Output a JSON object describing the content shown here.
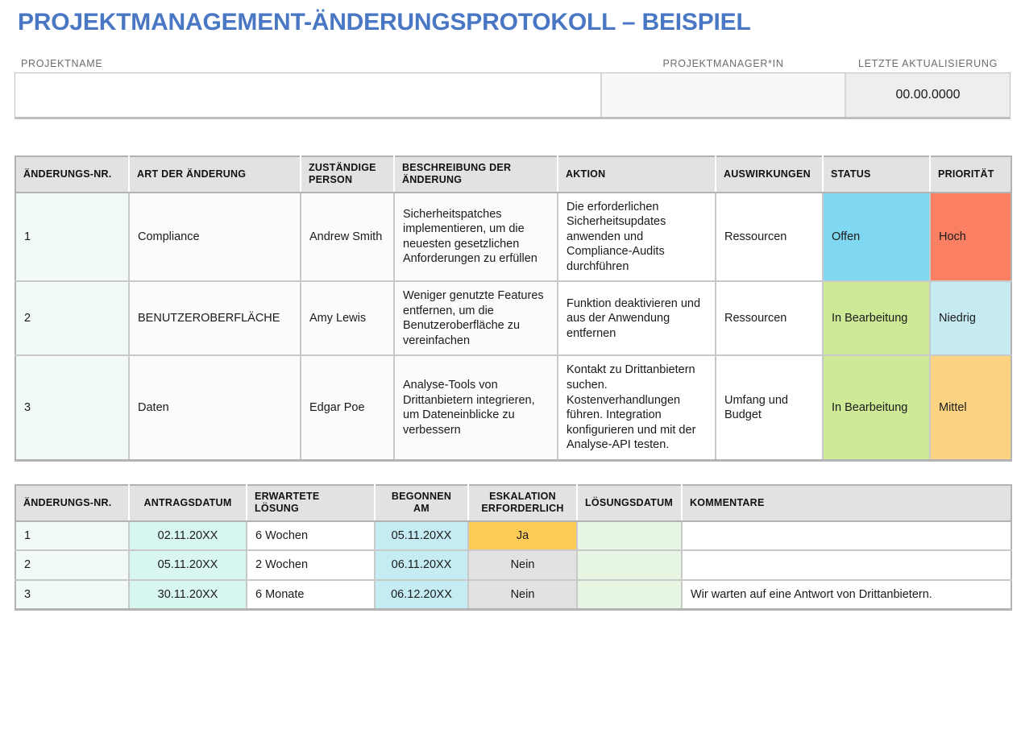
{
  "title": "PROJEKTMANAGEMENT-ÄNDERUNGSPROTOKOLL – BEISPIEL",
  "header": {
    "label_project_name": "PROJEKTNAME",
    "label_project_manager": "PROJEKTMANAGER*IN",
    "label_last_update": "LETZTE AKTUALISIERUNG",
    "value_project_name": "",
    "value_project_manager": "",
    "value_last_update": "00.00.0000"
  },
  "colors": {
    "title": "#4977c4",
    "header_bg": "#e2e2e2",
    "status_open": "#7fd7f2",
    "status_in_progress": "#cfea96",
    "priority_high": "#fb8063",
    "priority_low": "#c6eaf1",
    "priority_medium": "#fcd383",
    "escalation_yes": "#fbcb55",
    "escalation_no": "#e2e2e2",
    "date_mint": "#d9f7f1",
    "date_cyan": "#c5ecf2",
    "resolution_date": "#e7f6e3"
  },
  "table1": {
    "headers": [
      "ÄNDERUNGS-NR.",
      "ART DER ÄNDERUNG",
      "ZUSTÄNDIGE PERSON",
      "BESCHREIBUNG DER ÄNDERUNG",
      "AKTION",
      "AUSWIRKUNGEN",
      "STATUS",
      "PRIORITÄT"
    ],
    "rows": [
      {
        "nr": "1",
        "art": "Compliance",
        "person": "Andrew Smith",
        "beschreibung": "Sicherheitspatches implementieren, um die neuesten gesetzlichen Anforderungen zu erfüllen",
        "aktion": "Die erforderlichen Sicherheitsupdates anwenden und Compliance-Audits durchführen",
        "auswirkungen": "Ressourcen",
        "status": "Offen",
        "prioritaet": "Hoch"
      },
      {
        "nr": "2",
        "art": "BENUTZEROBERFLÄCHE",
        "person": "Amy Lewis",
        "beschreibung": "Weniger genutzte Features entfernen, um die Benutzeroberfläche zu vereinfachen",
        "aktion": "Funktion deaktivieren und aus der Anwendung entfernen",
        "auswirkungen": "Ressourcen",
        "status": "In Bearbeitung",
        "prioritaet": "Niedrig"
      },
      {
        "nr": "3",
        "art": "Daten",
        "person": "Edgar Poe",
        "beschreibung": "Analyse-Tools von Drittanbietern integrieren, um Dateneinblicke zu verbessern",
        "aktion": "Kontakt zu Drittanbietern suchen. Kostenverhandlungen führen. Integration konfigurieren und mit der Analyse-API testen.",
        "auswirkungen": "Umfang und Budget",
        "status": "In Bearbeitung",
        "prioritaet": "Mittel"
      }
    ]
  },
  "table2": {
    "headers": [
      "ÄNDERUNGS-NR.",
      "ANTRAGSDATUM",
      "ERWARTETE LÖSUNG",
      "BEGONNEN AM",
      "ESKALATION ERFORDERLICH",
      "LÖSUNGSDATUM",
      "KOMMENTARE"
    ],
    "rows": [
      {
        "nr": "1",
        "antragsdatum": "02.11.20XX",
        "erwartete_loesung": "6 Wochen",
        "begonnen_am": "05.11.20XX",
        "eskalation": "Ja",
        "loesungsdatum": "",
        "kommentare": ""
      },
      {
        "nr": "2",
        "antragsdatum": "05.11.20XX",
        "erwartete_loesung": "2 Wochen",
        "begonnen_am": "06.11.20XX",
        "eskalation": "Nein",
        "loesungsdatum": "",
        "kommentare": ""
      },
      {
        "nr": "3",
        "antragsdatum": "30.11.20XX",
        "erwartete_loesung": "6 Monate",
        "begonnen_am": "06.12.20XX",
        "eskalation": "Nein",
        "loesungsdatum": "",
        "kommentare": "Wir warten auf eine Antwort von Drittanbietern."
      }
    ]
  }
}
